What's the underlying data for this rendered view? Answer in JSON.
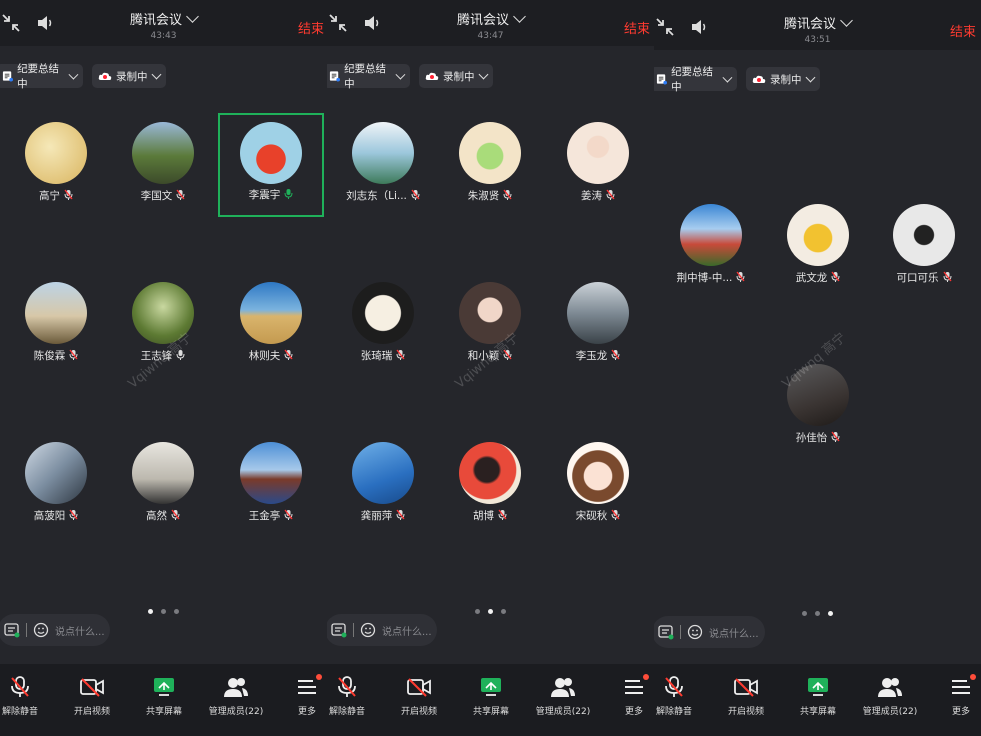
{
  "panels": [
    {
      "title": "腾讯会议",
      "timer": "43:43",
      "end_label": "结束",
      "summary_label": "纪要总结中",
      "record_label": "录制中",
      "participants": [
        {
          "name": "高宁",
          "mic": "muted"
        },
        {
          "name": "李国文",
          "mic": "muted"
        },
        {
          "name": "李震宇",
          "mic": "speaking"
        },
        {
          "name": "陈俊霖",
          "mic": "muted"
        },
        {
          "name": "王志锋",
          "mic": "on"
        },
        {
          "name": "林则夫",
          "mic": "muted"
        },
        {
          "name": "高菠阳",
          "mic": "muted"
        },
        {
          "name": "高然",
          "mic": "muted"
        },
        {
          "name": "王金亭",
          "mic": "muted"
        }
      ],
      "active_page": 0,
      "chat_placeholder": "说点什么...",
      "toolbar": [
        "解除静音",
        "开启视频",
        "共享屏幕",
        "管理成员(22)",
        "更多"
      ],
      "watermark": "Vqiwnq 高宁"
    },
    {
      "title": "腾讯会议",
      "timer": "43:47",
      "end_label": "结束",
      "summary_label": "纪要总结中",
      "record_label": "录制中",
      "participants": [
        {
          "name": "刘志东（Li...",
          "mic": "muted"
        },
        {
          "name": "朱淑贤",
          "mic": "muted"
        },
        {
          "name": "姜涛",
          "mic": "muted"
        },
        {
          "name": "张琦瑞",
          "mic": "muted"
        },
        {
          "name": "和小颖",
          "mic": "muted"
        },
        {
          "name": "李玉龙",
          "mic": "muted"
        },
        {
          "name": "龚丽萍",
          "mic": "muted"
        },
        {
          "name": "胡博",
          "mic": "muted"
        },
        {
          "name": "宋砚秋",
          "mic": "muted"
        }
      ],
      "active_page": 1,
      "chat_placeholder": "说点什么...",
      "toolbar": [
        "解除静音",
        "开启视频",
        "共享屏幕",
        "管理成员(22)",
        "更多"
      ],
      "watermark": "Vqiwnq 高宁"
    },
    {
      "title": "腾讯会议",
      "timer": "43:51",
      "end_label": "结束",
      "summary_label": "纪要总结中",
      "record_label": "录制中",
      "participants": [
        {
          "name": "荆中博-中...",
          "mic": "muted"
        },
        {
          "name": "武文龙",
          "mic": "muted"
        },
        {
          "name": "可口可乐",
          "mic": "muted"
        },
        {
          "name": "孙佳怡",
          "mic": "muted"
        }
      ],
      "active_page": 2,
      "chat_placeholder": "说点什么...",
      "toolbar": [
        "解除静音",
        "开启视频",
        "共享屏幕",
        "管理成员(22)",
        "更多"
      ],
      "watermark": "Vqiwnq 高宁"
    }
  ],
  "colors": {
    "accent_green": "#1fb15a",
    "end_red": "#ff3b30",
    "background": "#25262b"
  }
}
